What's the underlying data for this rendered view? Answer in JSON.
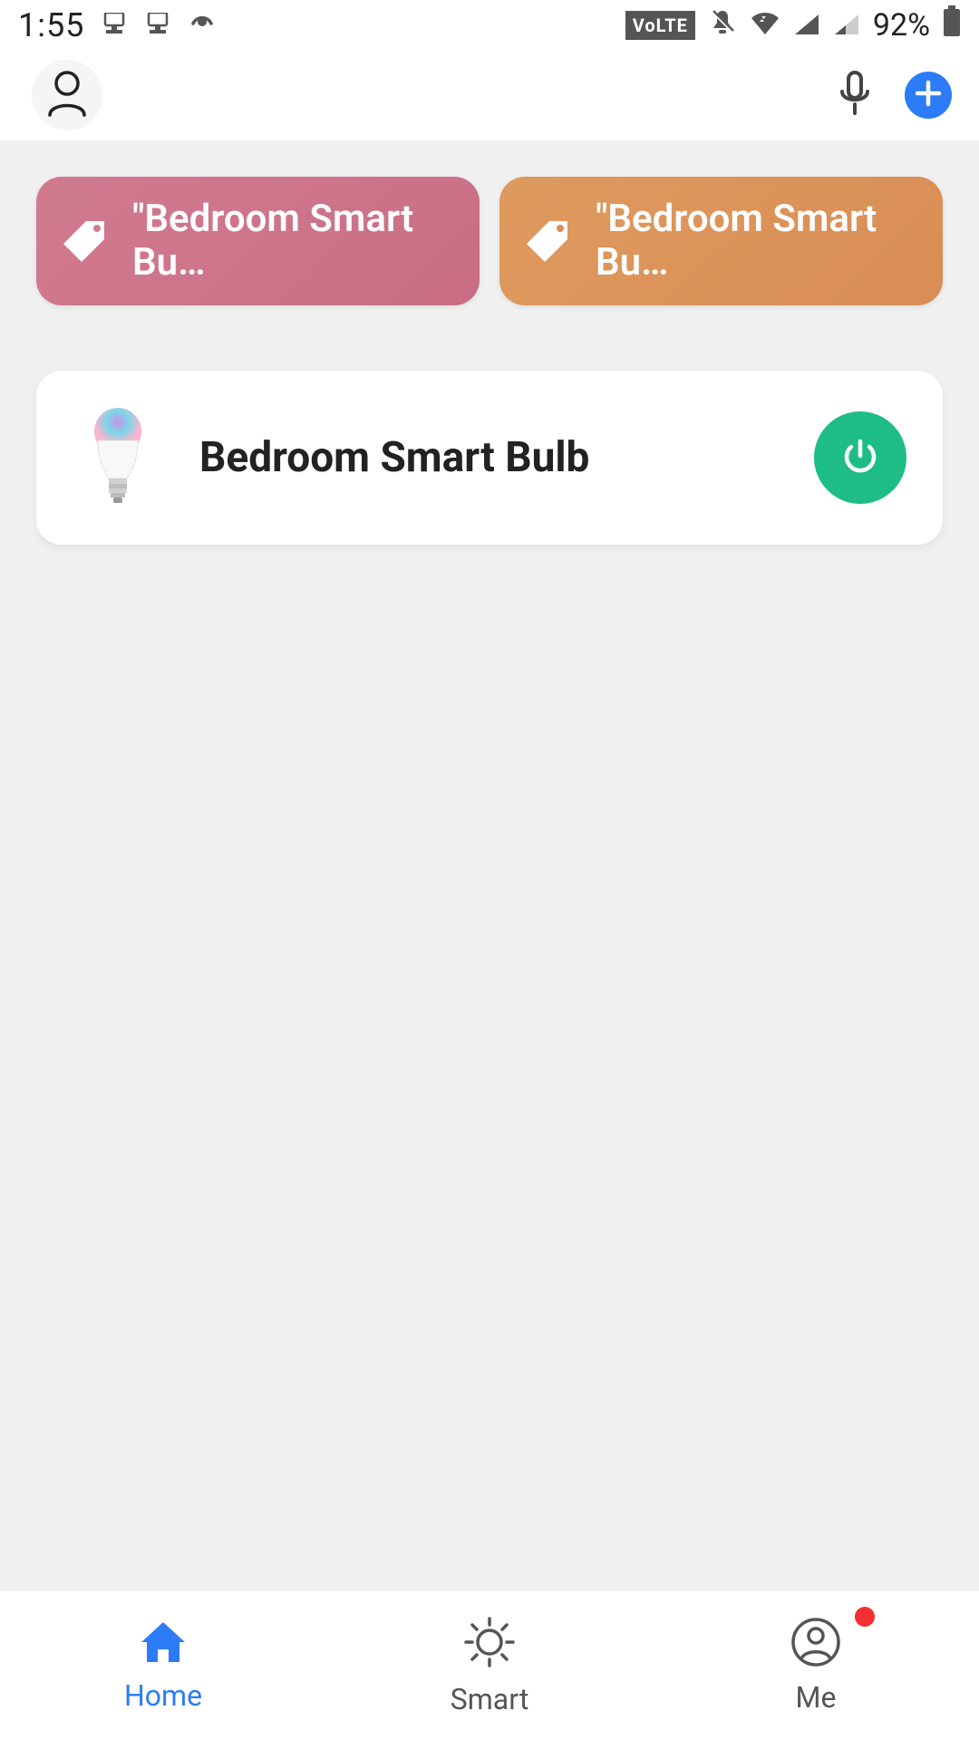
{
  "status_bar": {
    "time": "1:55",
    "volte_label": "VoLTE",
    "battery_percent": "92%"
  },
  "header": {
    "icons": {
      "profile": "profile-icon",
      "mic": "mic-icon",
      "add": "plus-icon"
    }
  },
  "scenes": [
    {
      "label": "\"Bedroom Smart Bu…",
      "color": "pink"
    },
    {
      "label": "\"Bedroom Smart Bu…",
      "color": "orange"
    }
  ],
  "devices": [
    {
      "name": "Bedroom Smart Bulb",
      "power_on": true,
      "icon": "smart-bulb-icon",
      "accent_color": "#1fbd86"
    }
  ],
  "nav": {
    "items": [
      {
        "label": "Home",
        "icon": "home-icon",
        "active": true,
        "badge": false
      },
      {
        "label": "Smart",
        "icon": "sun-icon",
        "active": false,
        "badge": false
      },
      {
        "label": "Me",
        "icon": "user-circle-icon",
        "active": false,
        "badge": true
      }
    ]
  }
}
